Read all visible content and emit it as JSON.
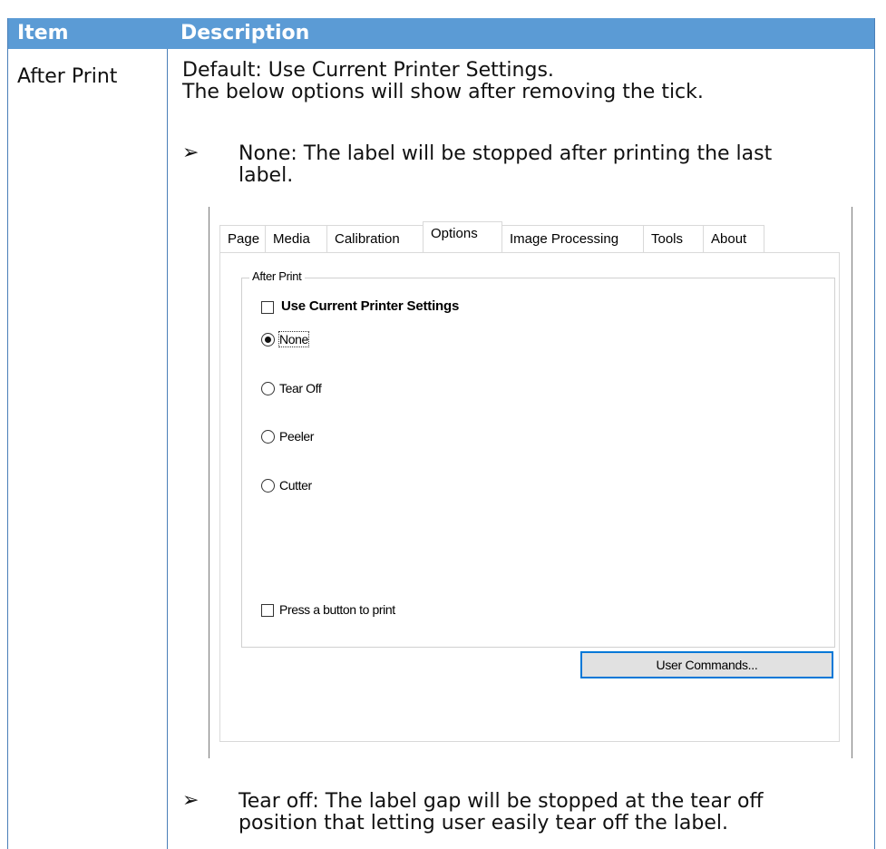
{
  "table": {
    "headers": {
      "item": "Item",
      "description": "Description"
    },
    "row": {
      "item": "After Print",
      "lines": [
        "Default: Use Current Printer Settings.",
        "The below options will show after removing the tick."
      ],
      "bullets": [
        {
          "symbol": "➢",
          "lines": [
            "None: The label will be stopped after printing the last",
            "label."
          ]
        },
        {
          "symbol": "➢",
          "lines": [
            "Tear off: The label gap will be stopped at the tear off",
            "position that letting user easily tear off the label."
          ]
        }
      ]
    }
  },
  "dialog": {
    "tabs": [
      "Page",
      "Media",
      "Calibration",
      "Options",
      "Image Processing",
      "Tools",
      "About"
    ],
    "active_tab": "Options",
    "group_title": "After Print",
    "use_current_label": "Use Current Printer Settings",
    "use_current_checked": false,
    "radio_options": [
      "None",
      "Tear Off",
      "Peeler",
      "Cutter"
    ],
    "selected_option": "None",
    "press_button_label": "Press a button to print",
    "press_button_checked": false,
    "user_commands_label": "User Commands..."
  },
  "colors": {
    "header_bg": "#5b9bd5",
    "header_text": "#ffffff",
    "button_border": "#0078d7"
  }
}
